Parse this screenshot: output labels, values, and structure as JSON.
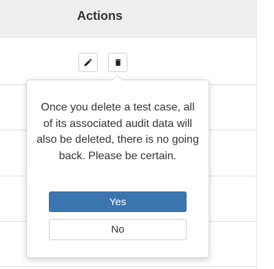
{
  "table": {
    "header": {
      "actions_label": "Actions"
    },
    "row_actions": {
      "edit_icon": "pencil-icon",
      "delete_icon": "trash-icon"
    }
  },
  "delete_confirm": {
    "message": "Once you delete a test case, all of its associated audit data will also be deleted, there is no going back. Please be certain.",
    "confirm_label": "Yes",
    "cancel_label": "No",
    "confirm_color": "#3c76b0"
  }
}
